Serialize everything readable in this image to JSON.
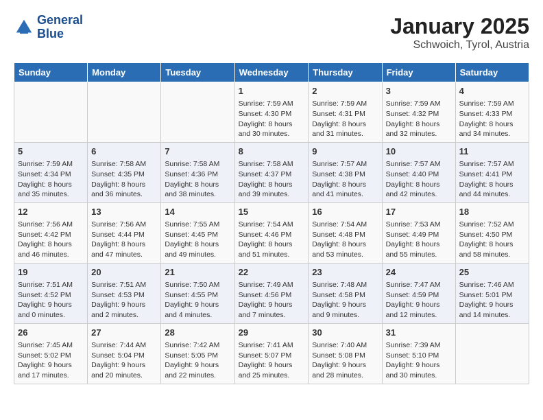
{
  "logo": {
    "text_general": "General",
    "text_blue": "Blue"
  },
  "title": "January 2025",
  "subtitle": "Schwoich, Tyrol, Austria",
  "days_of_week": [
    "Sunday",
    "Monday",
    "Tuesday",
    "Wednesday",
    "Thursday",
    "Friday",
    "Saturday"
  ],
  "weeks": [
    [
      {
        "day": "",
        "content": ""
      },
      {
        "day": "",
        "content": ""
      },
      {
        "day": "",
        "content": ""
      },
      {
        "day": "1",
        "content": "Sunrise: 7:59 AM\nSunset: 4:30 PM\nDaylight: 8 hours\nand 30 minutes."
      },
      {
        "day": "2",
        "content": "Sunrise: 7:59 AM\nSunset: 4:31 PM\nDaylight: 8 hours\nand 31 minutes."
      },
      {
        "day": "3",
        "content": "Sunrise: 7:59 AM\nSunset: 4:32 PM\nDaylight: 8 hours\nand 32 minutes."
      },
      {
        "day": "4",
        "content": "Sunrise: 7:59 AM\nSunset: 4:33 PM\nDaylight: 8 hours\nand 34 minutes."
      }
    ],
    [
      {
        "day": "5",
        "content": "Sunrise: 7:59 AM\nSunset: 4:34 PM\nDaylight: 8 hours\nand 35 minutes."
      },
      {
        "day": "6",
        "content": "Sunrise: 7:58 AM\nSunset: 4:35 PM\nDaylight: 8 hours\nand 36 minutes."
      },
      {
        "day": "7",
        "content": "Sunrise: 7:58 AM\nSunset: 4:36 PM\nDaylight: 8 hours\nand 38 minutes."
      },
      {
        "day": "8",
        "content": "Sunrise: 7:58 AM\nSunset: 4:37 PM\nDaylight: 8 hours\nand 39 minutes."
      },
      {
        "day": "9",
        "content": "Sunrise: 7:57 AM\nSunset: 4:38 PM\nDaylight: 8 hours\nand 41 minutes."
      },
      {
        "day": "10",
        "content": "Sunrise: 7:57 AM\nSunset: 4:40 PM\nDaylight: 8 hours\nand 42 minutes."
      },
      {
        "day": "11",
        "content": "Sunrise: 7:57 AM\nSunset: 4:41 PM\nDaylight: 8 hours\nand 44 minutes."
      }
    ],
    [
      {
        "day": "12",
        "content": "Sunrise: 7:56 AM\nSunset: 4:42 PM\nDaylight: 8 hours\nand 46 minutes."
      },
      {
        "day": "13",
        "content": "Sunrise: 7:56 AM\nSunset: 4:44 PM\nDaylight: 8 hours\nand 47 minutes."
      },
      {
        "day": "14",
        "content": "Sunrise: 7:55 AM\nSunset: 4:45 PM\nDaylight: 8 hours\nand 49 minutes."
      },
      {
        "day": "15",
        "content": "Sunrise: 7:54 AM\nSunset: 4:46 PM\nDaylight: 8 hours\nand 51 minutes."
      },
      {
        "day": "16",
        "content": "Sunrise: 7:54 AM\nSunset: 4:48 PM\nDaylight: 8 hours\nand 53 minutes."
      },
      {
        "day": "17",
        "content": "Sunrise: 7:53 AM\nSunset: 4:49 PM\nDaylight: 8 hours\nand 55 minutes."
      },
      {
        "day": "18",
        "content": "Sunrise: 7:52 AM\nSunset: 4:50 PM\nDaylight: 8 hours\nand 58 minutes."
      }
    ],
    [
      {
        "day": "19",
        "content": "Sunrise: 7:51 AM\nSunset: 4:52 PM\nDaylight: 9 hours\nand 0 minutes."
      },
      {
        "day": "20",
        "content": "Sunrise: 7:51 AM\nSunset: 4:53 PM\nDaylight: 9 hours\nand 2 minutes."
      },
      {
        "day": "21",
        "content": "Sunrise: 7:50 AM\nSunset: 4:55 PM\nDaylight: 9 hours\nand 4 minutes."
      },
      {
        "day": "22",
        "content": "Sunrise: 7:49 AM\nSunset: 4:56 PM\nDaylight: 9 hours\nand 7 minutes."
      },
      {
        "day": "23",
        "content": "Sunrise: 7:48 AM\nSunset: 4:58 PM\nDaylight: 9 hours\nand 9 minutes."
      },
      {
        "day": "24",
        "content": "Sunrise: 7:47 AM\nSunset: 4:59 PM\nDaylight: 9 hours\nand 12 minutes."
      },
      {
        "day": "25",
        "content": "Sunrise: 7:46 AM\nSunset: 5:01 PM\nDaylight: 9 hours\nand 14 minutes."
      }
    ],
    [
      {
        "day": "26",
        "content": "Sunrise: 7:45 AM\nSunset: 5:02 PM\nDaylight: 9 hours\nand 17 minutes."
      },
      {
        "day": "27",
        "content": "Sunrise: 7:44 AM\nSunset: 5:04 PM\nDaylight: 9 hours\nand 20 minutes."
      },
      {
        "day": "28",
        "content": "Sunrise: 7:42 AM\nSunset: 5:05 PM\nDaylight: 9 hours\nand 22 minutes."
      },
      {
        "day": "29",
        "content": "Sunrise: 7:41 AM\nSunset: 5:07 PM\nDaylight: 9 hours\nand 25 minutes."
      },
      {
        "day": "30",
        "content": "Sunrise: 7:40 AM\nSunset: 5:08 PM\nDaylight: 9 hours\nand 28 minutes."
      },
      {
        "day": "31",
        "content": "Sunrise: 7:39 AM\nSunset: 5:10 PM\nDaylight: 9 hours\nand 30 minutes."
      },
      {
        "day": "",
        "content": ""
      }
    ]
  ]
}
